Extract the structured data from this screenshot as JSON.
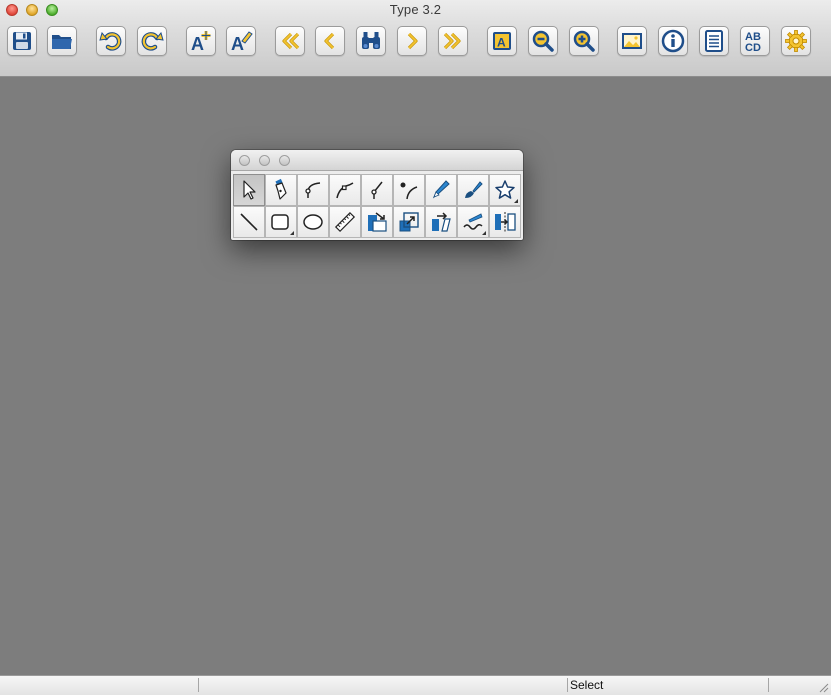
{
  "window": {
    "title": "Type 3.2"
  },
  "toolbar": {
    "buttons": [
      {
        "icon": "save-icon"
      },
      {
        "icon": "open-folder-icon"
      },
      {
        "icon": "undo-icon"
      },
      {
        "icon": "redo-icon"
      },
      {
        "icon": "add-glyph-icon"
      },
      {
        "icon": "edit-glyph-icon"
      },
      {
        "icon": "first-glyph-icon"
      },
      {
        "icon": "previous-glyph-icon"
      },
      {
        "icon": "find-binoculars-icon"
      },
      {
        "icon": "next-glyph-icon"
      },
      {
        "icon": "last-glyph-icon"
      },
      {
        "icon": "fit-glyph-icon"
      },
      {
        "icon": "zoom-out-icon"
      },
      {
        "icon": "zoom-in-icon"
      },
      {
        "icon": "background-image-icon"
      },
      {
        "icon": "info-icon"
      },
      {
        "icon": "font-info-icon"
      },
      {
        "icon": "text-preview-icon"
      },
      {
        "icon": "settings-gear-icon"
      }
    ]
  },
  "palette": {
    "tools": [
      {
        "icon": "select-arrow-icon",
        "selected": true
      },
      {
        "icon": "pen-nib-icon"
      },
      {
        "icon": "curve-node-icon"
      },
      {
        "icon": "corner-node-icon"
      },
      {
        "icon": "tangent-node-icon"
      },
      {
        "icon": "point-curve-icon"
      },
      {
        "icon": "pencil-icon"
      },
      {
        "icon": "brush-icon"
      },
      {
        "icon": "star-icon",
        "menu": true
      },
      {
        "icon": "line-icon"
      },
      {
        "icon": "rectangle-icon",
        "menu": true
      },
      {
        "icon": "ellipse-icon"
      },
      {
        "icon": "ruler-icon"
      },
      {
        "icon": "move-icon"
      },
      {
        "icon": "scale-icon"
      },
      {
        "icon": "skew-icon"
      },
      {
        "icon": "knife-icon",
        "menu": true
      },
      {
        "icon": "mirror-icon"
      }
    ]
  },
  "status": {
    "tool": "Select"
  },
  "colors": {
    "accent": "#1f4e8a",
    "highlight": "#f4c430",
    "canvas": "#7d7d7d"
  }
}
